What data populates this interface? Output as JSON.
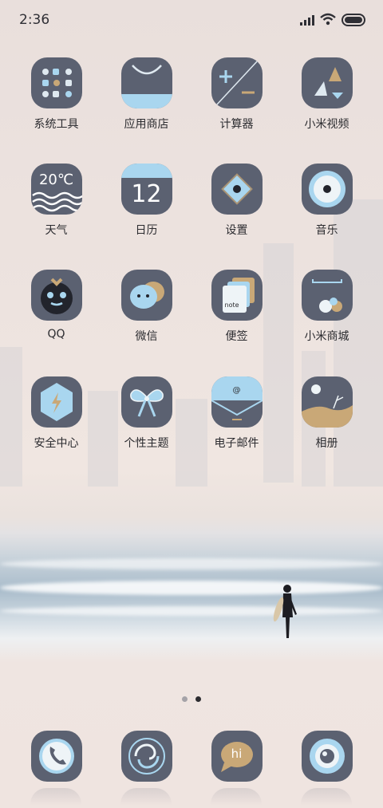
{
  "status_bar": {
    "time": "2:36"
  },
  "colors": {
    "tile": "#5b6171",
    "accent_blue": "#a9d6ef",
    "accent_gold": "#c9a877",
    "label": "#2c2c30"
  },
  "apps": [
    {
      "label": "系统工具",
      "icon": "tools-folder-icon"
    },
    {
      "label": "应用商店",
      "icon": "shopping-bag-icon"
    },
    {
      "label": "计算器",
      "icon": "calculator-icon"
    },
    {
      "label": "小米视频",
      "icon": "video-icon"
    },
    {
      "label": "天气",
      "icon": "weather-icon",
      "temperature": "20℃"
    },
    {
      "label": "日历",
      "icon": "calendar-icon",
      "day": "12"
    },
    {
      "label": "设置",
      "icon": "settings-icon"
    },
    {
      "label": "音乐",
      "icon": "music-icon"
    },
    {
      "label": "QQ",
      "icon": "qq-icon"
    },
    {
      "label": "微信",
      "icon": "wechat-icon"
    },
    {
      "label": "便签",
      "icon": "notes-icon",
      "note_text": "note"
    },
    {
      "label": "小米商城",
      "icon": "mi-store-icon"
    },
    {
      "label": "安全中心",
      "icon": "security-icon"
    },
    {
      "label": "个性主题",
      "icon": "themes-icon"
    },
    {
      "label": "电子邮件",
      "icon": "email-icon",
      "at": "@"
    },
    {
      "label": "相册",
      "icon": "gallery-icon"
    }
  ],
  "page_indicator": {
    "pages": 2,
    "current": 2
  },
  "dock": [
    {
      "icon": "phone-icon"
    },
    {
      "icon": "browser-icon"
    },
    {
      "icon": "messages-icon",
      "text": "hi"
    },
    {
      "icon": "camera-icon"
    }
  ]
}
